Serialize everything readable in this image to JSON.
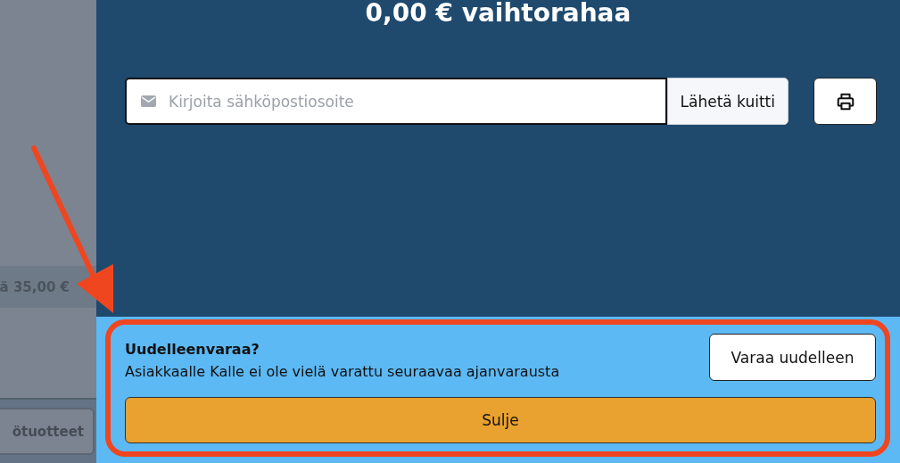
{
  "sidebar": {
    "total_row": "ä 35,00 €",
    "products_button": "ötuotteet"
  },
  "title": "0,00 € vaihtorahaa",
  "email": {
    "placeholder": "Kirjoita sähköpostiosoite",
    "send_button": "Lähetä kuitti"
  },
  "rebook": {
    "title": "Uudelleenvaraa?",
    "message": "Asiakkaalle Kalle ei ole vielä varattu seuraavaa ajanvarausta",
    "rebook_button": "Varaa uudelleen",
    "close_button": "Sulje",
    "highlighted": true
  }
}
